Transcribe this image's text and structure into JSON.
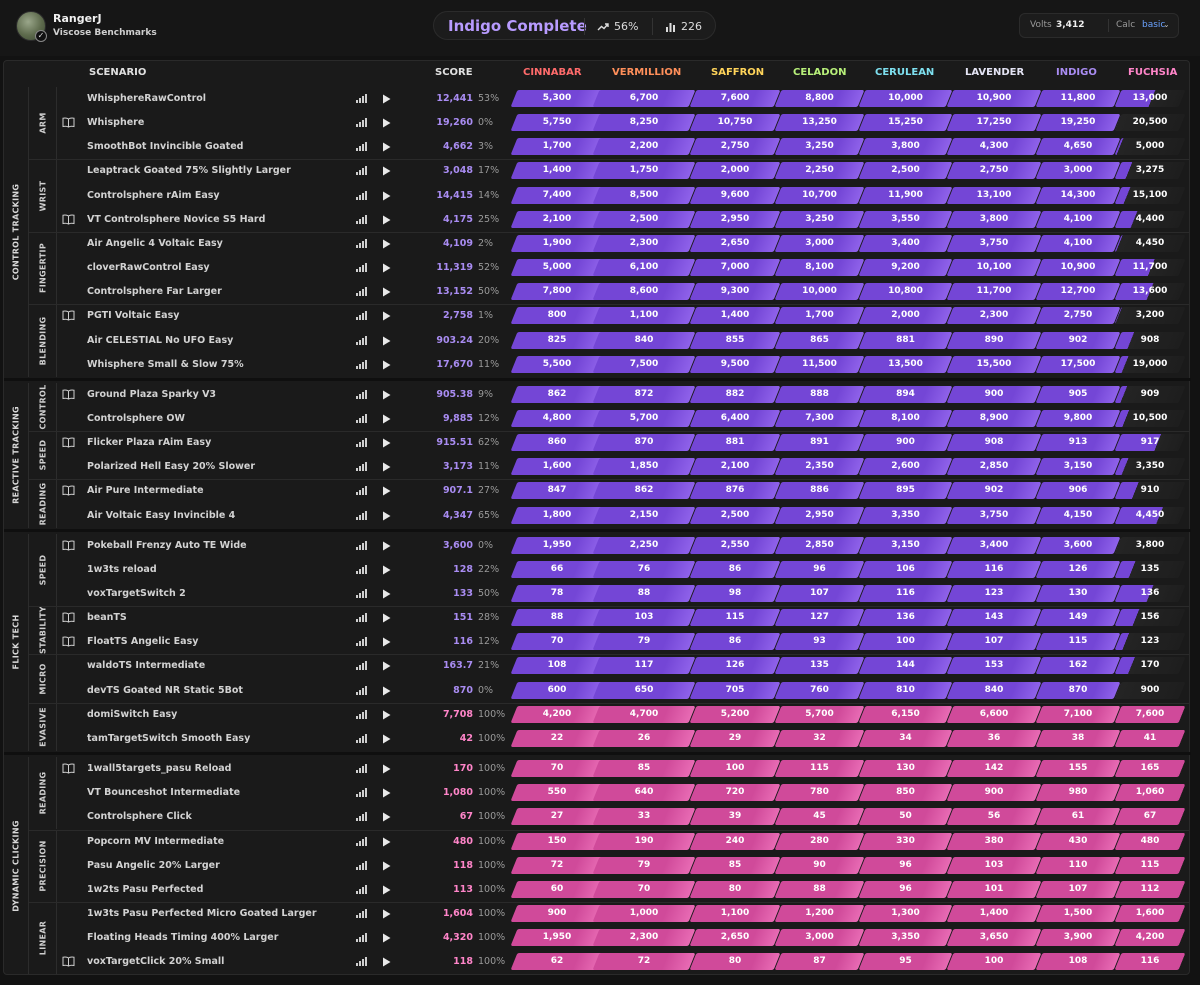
{
  "user": {
    "name": "RangerJ",
    "benchmark": "Viscose Benchmarks"
  },
  "rank": {
    "title": "Indigo Complete",
    "progress": "56%",
    "rank_count": "226"
  },
  "volts": {
    "label": "Volts",
    "value": "3,412"
  },
  "calc": {
    "label": "Calc",
    "value": "basic"
  },
  "columns": {
    "scenario": "SCENARIO",
    "score": "SCORE"
  },
  "ranks": [
    {
      "name": "CINNABAR",
      "color": "#ff6b6b"
    },
    {
      "name": "VERMILLION",
      "color": "#ff8f5a"
    },
    {
      "name": "SAFFRON",
      "color": "#ffd45a"
    },
    {
      "name": "CELADON",
      "color": "#b8f07a"
    },
    {
      "name": "CERULEAN",
      "color": "#7ee0f0"
    },
    {
      "name": "LAVENDER",
      "color": "#e4e4f4"
    },
    {
      "name": "INDIGO",
      "color": "#a98cf2"
    },
    {
      "name": "FUCHSIA",
      "color": "#ff85c9"
    }
  ],
  "colors": {
    "purple": "#7446d6",
    "pink": "#d04a9a",
    "score_purple": "#a98cf2",
    "score_pink": "#ff85c9"
  },
  "categories": [
    {
      "name": "CONTROL TRACKING",
      "subs": [
        {
          "name": "ARM",
          "rows": [
            {
              "name": "WhisphereRawControl",
              "score": "12,441",
              "pct": "53%",
              "book": false,
              "th": [
                "5,300",
                "6,700",
                "7,600",
                "8,800",
                "10,000",
                "10,900",
                "11,800",
                "13,000"
              ]
            },
            {
              "name": "Whisphere",
              "score": "19,260",
              "pct": "0%",
              "book": true,
              "th": [
                "5,750",
                "8,250",
                "10,750",
                "13,250",
                "15,250",
                "17,250",
                "19,250",
                "20,500"
              ]
            },
            {
              "name": "SmoothBot Invincible Goated",
              "score": "4,662",
              "pct": "3%",
              "book": false,
              "th": [
                "1,700",
                "2,200",
                "2,750",
                "3,250",
                "3,800",
                "4,300",
                "4,650",
                "5,000"
              ]
            }
          ]
        },
        {
          "name": "WRIST",
          "rows": [
            {
              "name": "Leaptrack Goated 75% Slightly Larger",
              "score": "3,048",
              "pct": "17%",
              "book": false,
              "th": [
                "1,400",
                "1,750",
                "2,000",
                "2,250",
                "2,500",
                "2,750",
                "3,000",
                "3,275"
              ]
            },
            {
              "name": "Controlsphere rAim Easy",
              "score": "14,415",
              "pct": "14%",
              "book": false,
              "th": [
                "7,400",
                "8,500",
                "9,600",
                "10,700",
                "11,900",
                "13,100",
                "14,300",
                "15,100"
              ]
            },
            {
              "name": "VT Controlsphere Novice S5 Hard",
              "score": "4,175",
              "pct": "25%",
              "book": true,
              "th": [
                "2,100",
                "2,500",
                "2,950",
                "3,250",
                "3,550",
                "3,800",
                "4,100",
                "4,400"
              ]
            }
          ]
        },
        {
          "name": "FINGERTIP",
          "rows": [
            {
              "name": "Air Angelic 4 Voltaic Easy",
              "score": "4,109",
              "pct": "2%",
              "book": false,
              "th": [
                "1,900",
                "2,300",
                "2,650",
                "3,000",
                "3,400",
                "3,750",
                "4,100",
                "4,450"
              ]
            },
            {
              "name": "cloverRawControl Easy",
              "score": "11,319",
              "pct": "52%",
              "book": false,
              "th": [
                "5,000",
                "6,100",
                "7,000",
                "8,100",
                "9,200",
                "10,100",
                "10,900",
                "11,700"
              ]
            },
            {
              "name": "Controlsphere Far Larger",
              "score": "13,152",
              "pct": "50%",
              "book": false,
              "th": [
                "7,800",
                "8,600",
                "9,300",
                "10,000",
                "10,800",
                "11,700",
                "12,700",
                "13,600"
              ]
            }
          ]
        },
        {
          "name": "BLENDING",
          "rows": [
            {
              "name": "PGTI Voltaic Easy",
              "score": "2,758",
              "pct": "1%",
              "book": true,
              "th": [
                "800",
                "1,100",
                "1,400",
                "1,700",
                "2,000",
                "2,300",
                "2,750",
                "3,200"
              ]
            },
            {
              "name": "Air CELESTIAL No UFO Easy",
              "score": "903.24",
              "pct": "20%",
              "book": false,
              "th": [
                "825",
                "840",
                "855",
                "865",
                "881",
                "890",
                "902",
                "908"
              ]
            },
            {
              "name": "Whisphere Small & Slow 75%",
              "score": "17,670",
              "pct": "11%",
              "book": false,
              "th": [
                "5,500",
                "7,500",
                "9,500",
                "11,500",
                "13,500",
                "15,500",
                "17,500",
                "19,000"
              ]
            }
          ]
        }
      ]
    },
    {
      "name": "REACTIVE TRACKING",
      "subs": [
        {
          "name": "CONTROL",
          "rows": [
            {
              "name": "Ground Plaza Sparky V3",
              "score": "905.38",
              "pct": "9%",
              "book": true,
              "th": [
                "862",
                "872",
                "882",
                "888",
                "894",
                "900",
                "905",
                "909"
              ]
            },
            {
              "name": "Controlsphere OW",
              "score": "9,885",
              "pct": "12%",
              "book": false,
              "th": [
                "4,800",
                "5,700",
                "6,400",
                "7,300",
                "8,100",
                "8,900",
                "9,800",
                "10,500"
              ]
            }
          ]
        },
        {
          "name": "SPEED",
          "rows": [
            {
              "name": "Flicker Plaza rAim Easy",
              "score": "915.51",
              "pct": "62%",
              "book": true,
              "th": [
                "860",
                "870",
                "881",
                "891",
                "900",
                "908",
                "913",
                "917"
              ]
            },
            {
              "name": "Polarized Hell Easy 20% Slower",
              "score": "3,173",
              "pct": "11%",
              "book": false,
              "th": [
                "1,600",
                "1,850",
                "2,100",
                "2,350",
                "2,600",
                "2,850",
                "3,150",
                "3,350"
              ]
            }
          ]
        },
        {
          "name": "READING",
          "rows": [
            {
              "name": "Air Pure Intermediate",
              "score": "907.1",
              "pct": "27%",
              "book": true,
              "th": [
                "847",
                "862",
                "876",
                "886",
                "895",
                "902",
                "906",
                "910"
              ]
            },
            {
              "name": "Air Voltaic Easy Invincible 4",
              "score": "4,347",
              "pct": "65%",
              "book": false,
              "th": [
                "1,800",
                "2,150",
                "2,500",
                "2,950",
                "3,350",
                "3,750",
                "4,150",
                "4,450"
              ]
            }
          ]
        }
      ]
    },
    {
      "name": "FLICK TECH",
      "subs": [
        {
          "name": "SPEED",
          "rows": [
            {
              "name": "Pokeball Frenzy Auto TE Wide",
              "score": "3,600",
              "pct": "0%",
              "book": true,
              "th": [
                "1,950",
                "2,250",
                "2,550",
                "2,850",
                "3,150",
                "3,400",
                "3,600",
                "3,800"
              ]
            },
            {
              "name": "1w3ts reload",
              "score": "128",
              "pct": "22%",
              "book": false,
              "th": [
                "66",
                "76",
                "86",
                "96",
                "106",
                "116",
                "126",
                "135"
              ]
            },
            {
              "name": "voxTargetSwitch 2",
              "score": "133",
              "pct": "50%",
              "book": false,
              "th": [
                "78",
                "88",
                "98",
                "107",
                "116",
                "123",
                "130",
                "136"
              ]
            }
          ]
        },
        {
          "name": "STABILITY",
          "rows": [
            {
              "name": "beanTS",
              "score": "151",
              "pct": "28%",
              "book": true,
              "th": [
                "88",
                "103",
                "115",
                "127",
                "136",
                "143",
                "149",
                "156"
              ]
            },
            {
              "name": "FloatTS Angelic Easy",
              "score": "116",
              "pct": "12%",
              "book": true,
              "th": [
                "70",
                "79",
                "86",
                "93",
                "100",
                "107",
                "115",
                "123"
              ]
            }
          ]
        },
        {
          "name": "MICRO",
          "rows": [
            {
              "name": "waldoTS Intermediate",
              "score": "163.7",
              "pct": "21%",
              "book": false,
              "th": [
                "108",
                "117",
                "126",
                "135",
                "144",
                "153",
                "162",
                "170"
              ]
            },
            {
              "name": "devTS Goated NR Static 5Bot",
              "score": "870",
              "pct": "0%",
              "book": false,
              "th": [
                "600",
                "650",
                "705",
                "760",
                "810",
                "840",
                "870",
                "900"
              ]
            }
          ]
        },
        {
          "name": "EVASIVE",
          "rows": [
            {
              "name": "domiSwitch Easy",
              "score": "7,708",
              "pct": "100%",
              "book": false,
              "th": [
                "4,200",
                "4,700",
                "5,200",
                "5,700",
                "6,150",
                "6,600",
                "7,100",
                "7,600"
              ]
            },
            {
              "name": "tamTargetSwitch Smooth Easy",
              "score": "42",
              "pct": "100%",
              "book": false,
              "th": [
                "22",
                "26",
                "29",
                "32",
                "34",
                "36",
                "38",
                "41"
              ]
            }
          ]
        }
      ]
    },
    {
      "name": "DYNAMIC CLICKING",
      "subs": [
        {
          "name": "READING",
          "rows": [
            {
              "name": "1wall5targets_pasu Reload",
              "score": "170",
              "pct": "100%",
              "book": true,
              "th": [
                "70",
                "85",
                "100",
                "115",
                "130",
                "142",
                "155",
                "165"
              ]
            },
            {
              "name": "VT Bounceshot Intermediate",
              "score": "1,080",
              "pct": "100%",
              "book": false,
              "th": [
                "550",
                "640",
                "720",
                "780",
                "850",
                "900",
                "980",
                "1,060"
              ]
            },
            {
              "name": "Controlsphere Click",
              "score": "67",
              "pct": "100%",
              "book": false,
              "th": [
                "27",
                "33",
                "39",
                "45",
                "50",
                "56",
                "61",
                "67"
              ]
            }
          ]
        },
        {
          "name": "PRECISION",
          "rows": [
            {
              "name": "Popcorn MV Intermediate",
              "score": "480",
              "pct": "100%",
              "book": false,
              "th": [
                "150",
                "190",
                "240",
                "280",
                "330",
                "380",
                "430",
                "480"
              ]
            },
            {
              "name": "Pasu Angelic 20% Larger",
              "score": "118",
              "pct": "100%",
              "book": false,
              "th": [
                "72",
                "79",
                "85",
                "90",
                "96",
                "103",
                "110",
                "115"
              ]
            },
            {
              "name": "1w2ts Pasu Perfected",
              "score": "113",
              "pct": "100%",
              "book": false,
              "th": [
                "60",
                "70",
                "80",
                "88",
                "96",
                "101",
                "107",
                "112"
              ]
            }
          ]
        },
        {
          "name": "LINEAR",
          "rows": [
            {
              "name": "1w3ts Pasu Perfected Micro Goated Larger",
              "score": "1,604",
              "pct": "100%",
              "book": false,
              "th": [
                "900",
                "1,000",
                "1,100",
                "1,200",
                "1,300",
                "1,400",
                "1,500",
                "1,600"
              ]
            },
            {
              "name": "Floating Heads Timing 400% Larger",
              "score": "4,320",
              "pct": "100%",
              "book": false,
              "th": [
                "1,950",
                "2,300",
                "2,650",
                "3,000",
                "3,350",
                "3,650",
                "3,900",
                "4,200"
              ]
            },
            {
              "name": "voxTargetClick 20% Small",
              "score": "118",
              "pct": "100%",
              "book": true,
              "th": [
                "62",
                "72",
                "80",
                "87",
                "95",
                "100",
                "108",
                "116"
              ]
            }
          ]
        }
      ]
    }
  ]
}
